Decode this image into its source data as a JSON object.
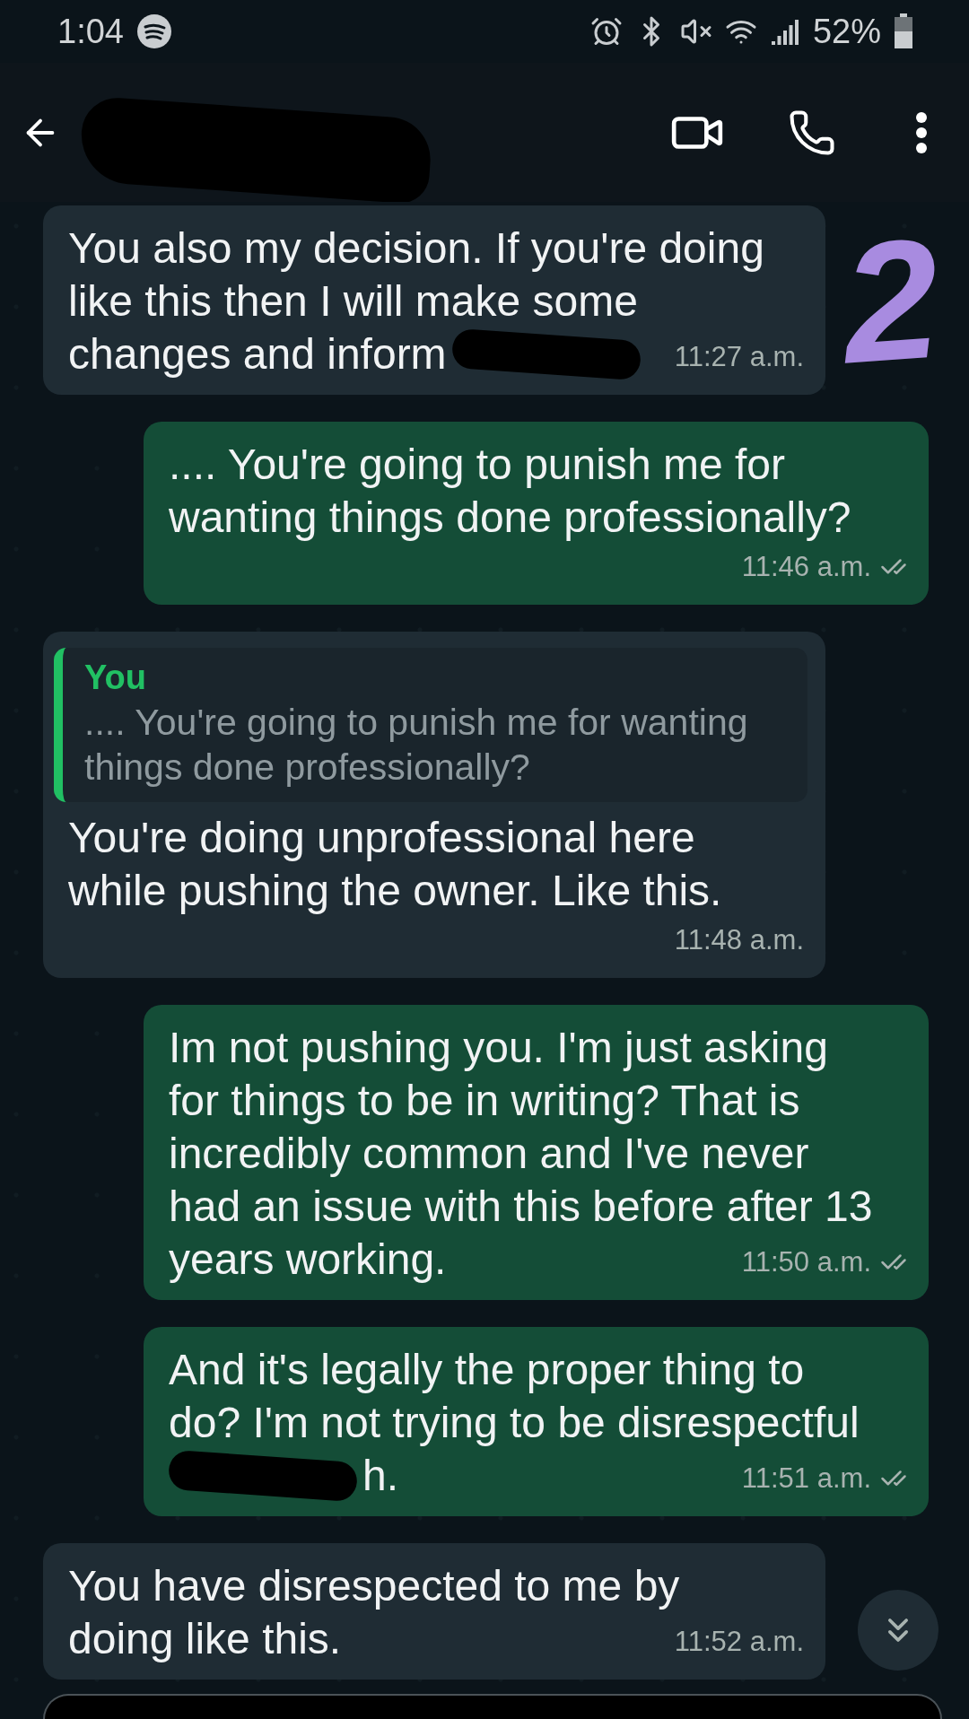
{
  "status_bar": {
    "time": "1:04",
    "battery": "52%"
  },
  "header": {
    "contact_name_redacted": true
  },
  "messages": [
    {
      "kind": "incoming",
      "lines": [
        [
          {
            "kind": "text",
            "text": "You also my decision. If you're doing"
          }
        ],
        [
          {
            "kind": "text",
            "text": "like this then I will make some"
          }
        ],
        [
          {
            "kind": "text",
            "text": "changes and inform"
          },
          {
            "kind": "redaction"
          }
        ]
      ],
      "time": "11:27 a.m.",
      "annotation": "2"
    },
    {
      "kind": "outgoing",
      "lines": [
        [
          {
            "kind": "text",
            "text": ".... You're going to punish me for"
          }
        ],
        [
          {
            "kind": "text",
            "text": "wanting things done professionally?"
          }
        ]
      ],
      "time": "11:46 a.m.",
      "read": false
    },
    {
      "kind": "incoming",
      "quote": {
        "author": "You",
        "text": ".... You're going to punish me for wanting things done professionally?"
      },
      "lines": [
        [
          {
            "kind": "text",
            "text": "You're doing unprofessional here"
          }
        ],
        [
          {
            "kind": "text",
            "text": "while pushing the owner. Like this."
          }
        ]
      ],
      "time": "11:48 a.m."
    },
    {
      "kind": "outgoing",
      "lines": [
        [
          {
            "kind": "text",
            "text": "Im not pushing you. I'm just asking"
          }
        ],
        [
          {
            "kind": "text",
            "text": "for things to be in writing? That is"
          }
        ],
        [
          {
            "kind": "text",
            "text": "incredibly common and I've never"
          }
        ],
        [
          {
            "kind": "text",
            "text": "had an issue with this before after 13"
          }
        ],
        [
          {
            "kind": "text",
            "text": "years working."
          }
        ]
      ],
      "time": "11:50 a.m.",
      "read": false
    },
    {
      "kind": "outgoing",
      "lines": [
        [
          {
            "kind": "text",
            "text": "And it's legally the proper thing to"
          }
        ],
        [
          {
            "kind": "text",
            "text": "do? I'm not trying to be disrespectful"
          }
        ],
        [
          {
            "kind": "redaction"
          },
          {
            "kind": "text",
            "text": "h."
          }
        ]
      ],
      "time": "11:51 a.m.",
      "read": false
    },
    {
      "kind": "incoming",
      "lines": [
        [
          {
            "kind": "text",
            "text": "You have disrespected to me by"
          }
        ],
        [
          {
            "kind": "text",
            "text": "doing like this."
          }
        ]
      ],
      "time": "11:52 a.m."
    }
  ]
}
